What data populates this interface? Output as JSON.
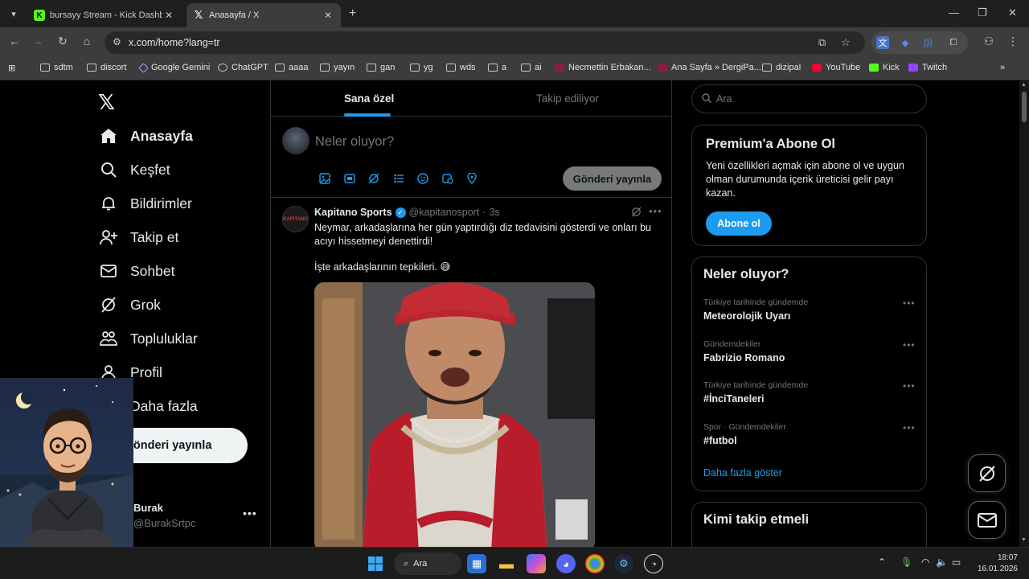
{
  "browser": {
    "tabs": [
      {
        "title": "bursayy Stream - Kick Dashboar",
        "favicon": "kick-icon"
      },
      {
        "title": "Anasayfa / X",
        "favicon": "x-icon",
        "active": true
      }
    ],
    "url": "x.com/home?lang=tr",
    "bookmarks": [
      "sdtm",
      "discort",
      "Google Gemini",
      "ChatGPT",
      "aaaa",
      "yayın",
      "gan",
      "yg",
      "wds",
      "a",
      "ai",
      "Necmettin Erbakan...",
      "Ana Sayfa » DergiPa...",
      "dizipal",
      "YouTube",
      "Kick",
      "Twitch"
    ]
  },
  "nav": {
    "items": [
      {
        "label": "Anasayfa",
        "icon": "home-icon"
      },
      {
        "label": "Keşfet",
        "icon": "search-icon"
      },
      {
        "label": "Bildirimler",
        "icon": "bell-icon"
      },
      {
        "label": "Takip et",
        "icon": "follow-icon"
      },
      {
        "label": "Sohbet",
        "icon": "mail-icon"
      },
      {
        "label": "Grok",
        "icon": "grok-icon"
      },
      {
        "label": "Topluluklar",
        "icon": "communities-icon"
      },
      {
        "label": "Profil",
        "icon": "profile-icon"
      },
      {
        "label": "Daha fazla",
        "icon": "more-icon"
      }
    ],
    "post_button": "Gönderi yayınla",
    "user": {
      "name": "Burak",
      "handle": "@BurakSrtpc"
    }
  },
  "feed": {
    "tabs": [
      "Sana özel",
      "Takip ediliyor"
    ],
    "composer": {
      "placeholder": "Neler oluyor?",
      "post_button": "Gönderi yayınla"
    },
    "tweet": {
      "author": "Kapitano Sports",
      "handle": "@kapitanosport",
      "time": "3s",
      "avatar_text": "KAPITANO",
      "text": "Neymar, arkadaşlarına her gün yaptırdığı diz tedavisini gösterdi ve onları bu acıyı hissetmeyi denettirdi!",
      "text2": "İşte arkadaşlarının tepkileri. 😅",
      "separator": "·"
    }
  },
  "sidebar": {
    "search_placeholder": "Ara",
    "premium": {
      "title": "Premium'a Abone Ol",
      "desc": "Yeni özellikleri açmak için abone ol ve uygun olman durumunda içerik üreticisi gelir payı kazan.",
      "button": "Abone ol"
    },
    "trends": {
      "title": "Neler oluyor?",
      "items": [
        {
          "context": "Türkiye tarihinde gündemde",
          "name": "Meteorolojik Uyarı"
        },
        {
          "context": "Gündemdekiler",
          "name": "Fabrizio Romano"
        },
        {
          "context": "Türkiye tarihinde gündemde",
          "name": "#İnciTaneleri"
        },
        {
          "context": "Spor · Gündemdekiler",
          "name": "#futbol"
        }
      ],
      "show_more": "Daha fazla göster"
    },
    "who_to_follow": {
      "title": "Kimi takip etmeli"
    }
  },
  "taskbar": {
    "search_label": "Ara",
    "time": "18:07",
    "date": "16.01.2026"
  },
  "colors": {
    "accent": "#1d9bf0",
    "background": "#000000",
    "border": "#2f3336",
    "muted": "#71767b"
  }
}
